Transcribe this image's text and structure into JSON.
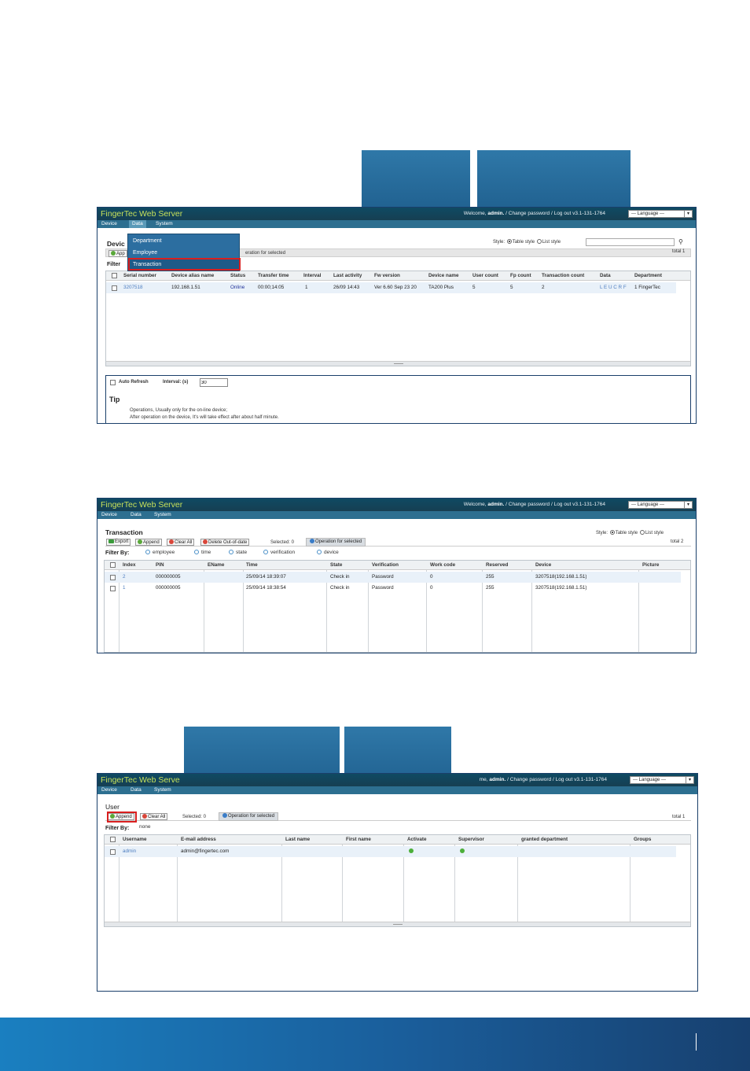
{
  "app": {
    "title": "FingerTec Web Server",
    "welcome_prefix": "Welcome, ",
    "welcome_user": "admin.",
    "welcome_suffix": " / Change password / Log out  v3.1-131-1764",
    "language": "--- Language ---",
    "menu": [
      "Device",
      "Data",
      "System"
    ]
  },
  "shot1": {
    "page_title": "Devic",
    "dropdown": [
      "Department",
      "Employee",
      "Transaction"
    ],
    "toolbar": {
      "append": "App",
      "op_selected": "eration for selected"
    },
    "style_label": "Style:",
    "table_style": "Table style",
    "list_style": "List style",
    "total": "total 1",
    "filter_label": "Filter",
    "columns": [
      "Serial number",
      "Device alias name",
      "Status",
      "Transfer time",
      "Interval",
      "Last activity",
      "Fw version",
      "Device name",
      "User count",
      "Fp count",
      "Transaction count",
      "Data",
      "Department"
    ],
    "rows": [
      [
        "3207518",
        "192.168.1.51",
        "Online",
        "00:00;14:05",
        "1",
        "26/09 14:43",
        "Ver 6.60 Sep 23 20",
        "TA200 Plus",
        "5",
        "5",
        "2",
        "L E U C R F",
        "1 FingerTec"
      ]
    ],
    "auto_refresh": "Auto Refresh",
    "interval_label": "Interval: (s)",
    "interval_value": "30",
    "tip_title": "Tip",
    "tip_lines": [
      "Operations, Usually only for the on-line device;",
      "After operation on the device, It's will take effect after about half minute."
    ]
  },
  "shot2": {
    "page_title": "Transaction",
    "toolbar": {
      "export": "Export",
      "append": "Append",
      "clear_all": "Clear All",
      "delete_out": "Delete Out-of-date",
      "selected": "Selected: 0",
      "op_selected": "Operation for selected"
    },
    "style_label": "Style:",
    "table_style": "Table style",
    "list_style": "List style",
    "total": "total 2",
    "filter_label": "Filter By:",
    "filters": [
      "employee",
      "time",
      "state",
      "verification",
      "device"
    ],
    "columns": [
      "Index",
      "PIN",
      "EName",
      "Time",
      "State",
      "Verification",
      "Work code",
      "Reserved",
      "Device",
      "Picture"
    ],
    "rows": [
      [
        "2",
        "000000005",
        "",
        "25/09/14 18:39:07",
        "Check in",
        "Password",
        "0",
        "255",
        "3207518(192.168.1.51)",
        ""
      ],
      [
        "1",
        "000000005",
        "",
        "25/09/14 18:38:54",
        "Check in",
        "Password",
        "0",
        "255",
        "3207518(192.168.1.51)",
        ""
      ]
    ]
  },
  "shot3": {
    "title_partial": "FingerTec Web Serve",
    "welcome_partial_prefix": "me, ",
    "welcome_user": "admin.",
    "welcome_suffix": " / Change password / Log out  v3.1-131-1764",
    "page_title": "User",
    "toolbar": {
      "append": "Append",
      "clear_all": "Clear All",
      "selected": "Selected: 0",
      "op_selected": "Operation for selected"
    },
    "total": "total 1",
    "filter_label": "Filter By:",
    "filter_value": "none",
    "columns": [
      "Username",
      "E-mail address",
      "Last name",
      "First name",
      "Activate",
      "Supervisor",
      "granted department",
      "Groups"
    ],
    "rows": [
      {
        "username": "admin",
        "email": "admin@fingertec.com"
      }
    ]
  },
  "colors": {
    "header_bg": "#0f4a63",
    "title_green": "#c6e05a",
    "highlight_red": "#d91f1f",
    "footer_blue": "#1a5d9a"
  }
}
